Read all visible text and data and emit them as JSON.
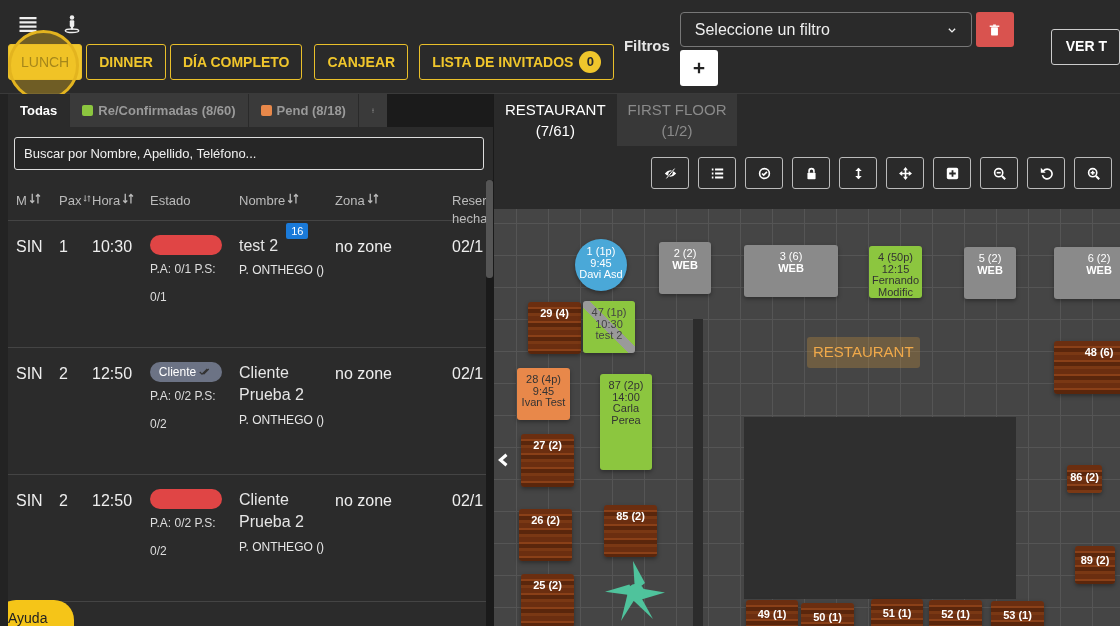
{
  "shifts": [
    {
      "label": "LUNCH",
      "selected": true
    },
    {
      "label": "DINNER",
      "selected": false
    },
    {
      "label": "DÍA COMPLETO",
      "selected": false
    },
    {
      "label": "CANJEAR",
      "selected": false
    },
    {
      "label": "LISTA DE INVITADOS",
      "selected": false,
      "count": "0"
    }
  ],
  "filters": {
    "label": "Filtros",
    "select": "Seleccione un filtro"
  },
  "view_button": "VER T",
  "list_tabs": [
    {
      "label": "Todas",
      "selected": true
    },
    {
      "label": "Re/Confirmadas (8/60)",
      "selected": false,
      "color": "#8cc63f"
    },
    {
      "label": "Pend (8/18)",
      "selected": false,
      "color": "#e8884a"
    }
  ],
  "search": {
    "placeholder": "Buscar por Nombre, Apellido, Teléfono..."
  },
  "table": {
    "columns": [
      {
        "label": "M",
        "sortable": true
      },
      {
        "label": "Pax",
        "sortable": true
      },
      {
        "label": "Hora",
        "sortable": true
      },
      {
        "label": "Estado",
        "sortable": false
      },
      {
        "label": "Nombre",
        "sortable": true
      },
      {
        "label": "Zona",
        "sortable": true
      },
      {
        "label": "Reser hecha",
        "sortable": false
      }
    ],
    "rows": [
      {
        "m": "SIN",
        "pax": "1",
        "time": "10:30",
        "status": {
          "color": "#e04545"
        },
        "payments": "P.A: 0/1 P.S: 0/1",
        "name": "test 2",
        "badge": "16",
        "source": "P. ONTHEGO ()",
        "zone": "no zone",
        "date": "02/1"
      },
      {
        "m": "SIN",
        "pax": "2",
        "time": "12:50",
        "status": {
          "color": "#6c7385",
          "label": "Cliente"
        },
        "payments": "P.A: 0/2 P.S: 0/2",
        "name": "Cliente Prueba 2",
        "source": "P. ONTHEGO ()",
        "zone": "no zone",
        "date": "02/1"
      },
      {
        "m": "SIN",
        "pax": "2",
        "time": "12:50",
        "status": {
          "color": "#e04545"
        },
        "payments": "P.A: 0/2 P.S: 0/2",
        "name": "Cliente Prueba 2",
        "source": "P. ONTHEGO ()",
        "zone": "no zone",
        "date": "02/1"
      }
    ]
  },
  "floor_tabs": [
    {
      "label": "RESTAURANT",
      "count": "(7/61)",
      "selected": true
    },
    {
      "label": "FIRST FLOOR",
      "count": "(1/2)",
      "selected": false
    }
  ],
  "floor_plan": {
    "zone_label": "RESTAURANT",
    "tables": [
      {
        "kind": "round",
        "color": "#4aa8d8",
        "lines": [
          "1 (1p)",
          "9:45",
          "Davi Asd"
        ]
      },
      {
        "kind": "plain",
        "color": "#8a8a8a",
        "lines": [
          "2 (2)",
          "**WEB**"
        ]
      },
      {
        "kind": "plain",
        "color": "#8a8a8a",
        "lines": [
          "3 (6)",
          "**WEB**"
        ]
      },
      {
        "kind": "plain",
        "color": "#8cc63f",
        "lines": [
          "4 (50p)",
          "12:15",
          "Fernando",
          "Modific"
        ]
      },
      {
        "kind": "plain",
        "color": "#8a8a8a",
        "lines": [
          "5 (2)",
          "**WEB**"
        ]
      },
      {
        "kind": "plain",
        "color": "#8a8a8a",
        "lines": [
          "6 (2)",
          "**WEB**"
        ]
      },
      {
        "kind": "wood",
        "lines": [
          "29 (4)"
        ]
      },
      {
        "kind": "split",
        "color": "#8cc63f",
        "lines": [
          "47 (1p)",
          "10:30",
          "test 2"
        ]
      },
      {
        "kind": "wood",
        "lines": [
          "48 (6)"
        ]
      },
      {
        "kind": "plain",
        "color": "#e8884a",
        "lines": [
          "28 (4p)",
          "9:45",
          "Ivan Test"
        ]
      },
      {
        "kind": "plain",
        "color": "#8cc63f",
        "lines": [
          "87 (2p)",
          "14:00",
          "Carla",
          "Perea"
        ]
      },
      {
        "kind": "wood",
        "lines": [
          "27 (2)"
        ]
      },
      {
        "kind": "wood",
        "lines": [
          "86 (2)"
        ]
      },
      {
        "kind": "wood",
        "lines": [
          "26 (2)"
        ]
      },
      {
        "kind": "wood",
        "lines": [
          "85 (2)"
        ]
      },
      {
        "kind": "wood",
        "lines": [
          "89 (2)"
        ]
      },
      {
        "kind": "wood",
        "lines": [
          "25 (2)"
        ]
      },
      {
        "kind": "wood",
        "lines": [
          "49 (1)"
        ]
      },
      {
        "kind": "wood",
        "lines": [
          "50 (1)"
        ]
      },
      {
        "kind": "wood",
        "lines": [
          "51 (1)"
        ]
      },
      {
        "kind": "wood",
        "lines": [
          "52 (1)"
        ]
      },
      {
        "kind": "wood",
        "lines": [
          "53 (1)"
        ]
      }
    ]
  },
  "help_button": "Ayuda"
}
